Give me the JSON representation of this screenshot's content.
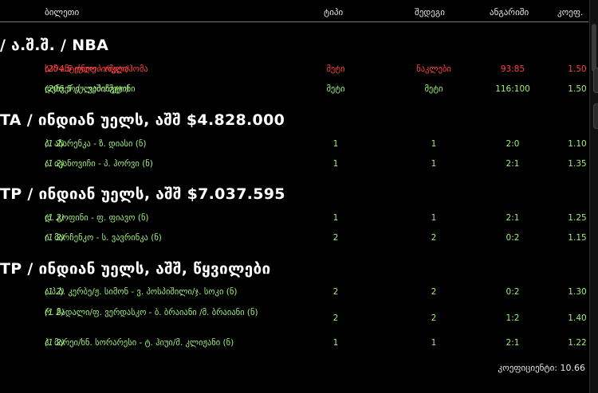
{
  "header": {
    "col_ticket": "ბილეთი",
    "col_type": "ტიპი",
    "col_outcome": "შედეგი",
    "col_score": "ანგარიში",
    "col_odds": "კოეფ."
  },
  "groups": [
    {
      "title": "/ ა.შ.შ. / NBA",
      "rows": [
        {
          "match": "სან ანტონიო - ოკლაჰომა",
          "detail": "(204.5 ქულები/მეტი)",
          "type": "მეტი",
          "outcome": "ნაკლები",
          "score": "93:85",
          "odds": "1.50",
          "status": "lost"
        },
        {
          "match": "დენვერი - ვაშინგტონი",
          "detail": "(206.5 ქულები/მეტი)",
          "type": "მეტი",
          "outcome": "მეტი",
          "score": "116:100",
          "odds": "1.50",
          "status": "won"
        }
      ]
    },
    {
      "title": "TA / ინდიან უელს, აშშ $4.828.000",
      "rows": [
        {
          "match": "პ. აზარენკა - ზ. დიასი (ნ)",
          "detail": "(1 2)",
          "type": "1",
          "outcome": "1",
          "score": "2:0",
          "odds": "1.10",
          "status": "won"
        },
        {
          "match": "ა. ივანოვიჩი - პ. ჰორვი (ნ)",
          "detail": "(1 2)",
          "type": "1",
          "outcome": "1",
          "score": "2:1",
          "odds": "1.35",
          "status": "won"
        }
      ]
    },
    {
      "title": "TP / ინდიან უელს, აშშ $7.037.595",
      "rows": [
        {
          "match": "დ. გოფინი - ფ. ფიავო (ნ)",
          "detail": "(1 2)",
          "type": "1",
          "outcome": "1",
          "score": "2:1",
          "odds": "1.25",
          "status": "won"
        },
        {
          "match": "ი. მარჩენკო - ს. ვავრინკა (ნ)",
          "detail": "(1 2)",
          "type": "2",
          "outcome": "2",
          "score": "0:2",
          "odds": "1.15",
          "status": "won"
        }
      ]
    },
    {
      "title": "TP / ინდიან უელს, აშშ, წყვილები",
      "rows": [
        {
          "match": "ა.პ.ბ. კერბე/ჟ. სიმონ - ვ. პოსპიშილი/ჯ. სოკი (ნ)",
          "detail": "(1 2)",
          "type": "2",
          "outcome": "2",
          "score": "0:2",
          "odds": "1.30",
          "status": "won"
        },
        {
          "match": "რ. ნადალი/ფ. ვერდასკო - ბ. ბრაიანი /მ. ბრაიანი (ნ)",
          "detail": "(1 2)",
          "type": "2",
          "outcome": "2",
          "score": "1:2",
          "odds": "1.40",
          "status": "won"
        },
        {
          "match": "ჰ. მარეი/ხნ. სორარესი - ტ. ჰიუი/მ. კლიჟანი (ნ)",
          "detail": "(1 2)",
          "type": "1",
          "outcome": "1",
          "score": "2:1",
          "odds": "1.22",
          "status": "won"
        }
      ]
    }
  ],
  "footer": {
    "total_label": "კოეფიციენტი: 10.66"
  },
  "colors": {
    "won": "#9ff07a",
    "lost": "#ff4040",
    "background": "#000000"
  }
}
